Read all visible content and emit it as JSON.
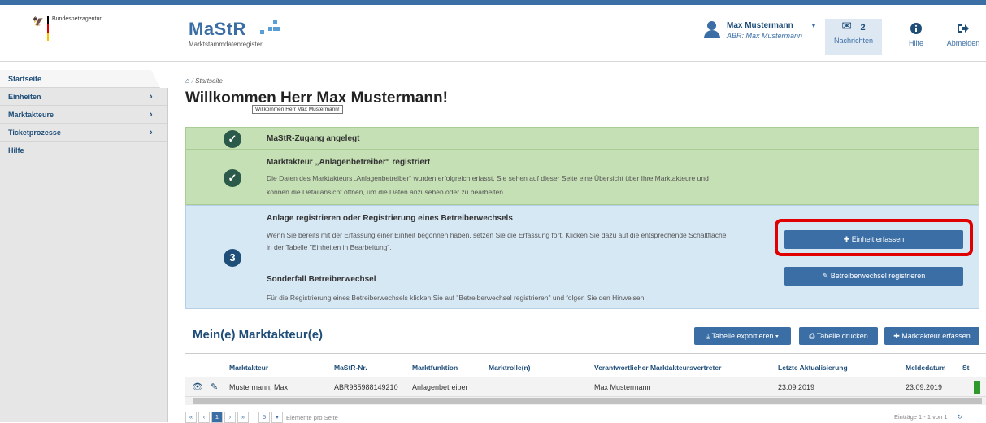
{
  "header": {
    "agency": "Bundesnetzagentur",
    "logo_main": "MaStR",
    "logo_sub": "Marktstammdatenregister",
    "user_name": "Max Mustermann",
    "user_abr": "ABR: Max Mustermann",
    "messages_count": "2",
    "messages_label": "Nachrichten",
    "help_label": "Hilfe",
    "logout_label": "Abmelden"
  },
  "sidebar": {
    "items": [
      {
        "label": "Startseite"
      },
      {
        "label": "Einheiten"
      },
      {
        "label": "Marktakteure"
      },
      {
        "label": "Ticketprozesse"
      },
      {
        "label": "Hilfe"
      }
    ]
  },
  "breadcrumb": "Startseite",
  "title": "Willkommen Herr Max Mustermann!",
  "tooltip": "Willkommen Herr Max Mustermann!",
  "steps": {
    "s1_title": "MaStR-Zugang angelegt",
    "s2_title": "Marktakteur „Anlagenbetreiber“ registriert",
    "s2_desc1": "Die Daten des Marktakteurs „Anlagenbetreiber“ wurden erfolgreich erfasst. Sie sehen auf dieser Seite eine Übersicht über Ihre Marktakteure und",
    "s2_desc2": "können die Detailansicht öffnen, um die Daten anzusehen oder zu bearbeiten.",
    "s3_number": "3",
    "s3_title": "Anlage registrieren oder Registrierung eines Betreiberwechsels",
    "s3_desc1": "Wenn Sie bereits mit der Erfassung einer Einheit begonnen haben, setzen Sie die Erfassung fort. Klicken Sie dazu auf die entsprechende Schaltfläche",
    "s3_desc2": "in der Tabelle \"Einheiten in Bearbeitung\".",
    "s3_sub_title": "Sonderfall Betreiberwechsel",
    "s3_sub_desc": "Für die Registrierung eines Betreiberwechsels klicken Sie auf \"Betreiberwechsel registrieren\" und folgen Sie den Hinweisen.",
    "btn_einheit": "Einheit erfassen",
    "btn_wechsel": "Betreiberwechsel registrieren"
  },
  "market": {
    "title": "Mein(e) Marktakteur(e)",
    "btn_export": "Tabelle exportieren",
    "btn_print": "Tabelle drucken",
    "btn_add": "Marktakteur erfassen",
    "columns": [
      "Marktakteur",
      "MaStR-Nr.",
      "Marktfunktion",
      "Marktrolle(n)",
      "Verantwortlicher Marktakteursvertreter",
      "Letzte Aktualisierung",
      "Meldedatum",
      "St"
    ],
    "row": {
      "name": "Mustermann, Max",
      "nr": "ABR985988149210",
      "function": "Anlagenbetreiber",
      "roles": "",
      "rep": "Max Mustermann",
      "updated": "23.09.2019",
      "date": "23.09.2019"
    },
    "pager": {
      "first": "«",
      "prev": "‹",
      "current": "1",
      "next": "›",
      "last": "»",
      "page_size": "5",
      "page_size_label": "Elemente pro Seite",
      "info": "Einträge 1 - 1 von 1"
    }
  }
}
